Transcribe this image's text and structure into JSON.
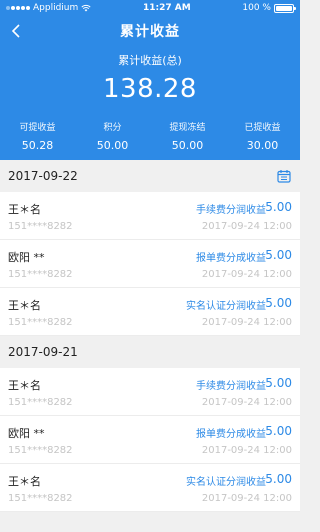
{
  "status": {
    "carrier": "Applidium",
    "time": "11:27 AM",
    "battery": "100 %"
  },
  "nav": {
    "title": "累计收益"
  },
  "summary": {
    "total_label": "累计收益(总)",
    "total_value": "138.28",
    "stats": [
      {
        "label": "可提收益",
        "value": "50.28"
      },
      {
        "label": "积分",
        "value": "50.00"
      },
      {
        "label": "提现冻结",
        "value": "50.00"
      },
      {
        "label": "已提收益",
        "value": "30.00"
      }
    ]
  },
  "groups": [
    {
      "date": "2017-09-22",
      "items": [
        {
          "name": "王＊名",
          "phone": "151****8282",
          "type": "手续费分润收益",
          "amount": "5.00",
          "time": "2017-09-24 12:00"
        },
        {
          "name": "欧阳 **",
          "phone": "151****8282",
          "type": "报单费分成收益",
          "amount": "5.00",
          "time": "2017-09-24 12:00"
        },
        {
          "name": "王＊名",
          "phone": "151****8282",
          "type": "实名认证分润收益",
          "amount": "5.00",
          "time": "2017-09-24 12:00"
        }
      ]
    },
    {
      "date": "2017-09-21",
      "items": [
        {
          "name": "王＊名",
          "phone": "151****8282",
          "type": "手续费分润收益",
          "amount": "5.00",
          "time": "2017-09-24 12:00"
        },
        {
          "name": "欧阳 **",
          "phone": "151****8282",
          "type": "报单费分成收益",
          "amount": "5.00",
          "time": "2017-09-24 12:00"
        },
        {
          "name": "王＊名",
          "phone": "151****8282",
          "type": "实名认证分润收益",
          "amount": "5.00",
          "time": "2017-09-24 12:00"
        }
      ]
    }
  ],
  "colors": {
    "primary": "#2d8ae6",
    "muted": "#c5c5c5",
    "background": "#f0f0f0"
  }
}
